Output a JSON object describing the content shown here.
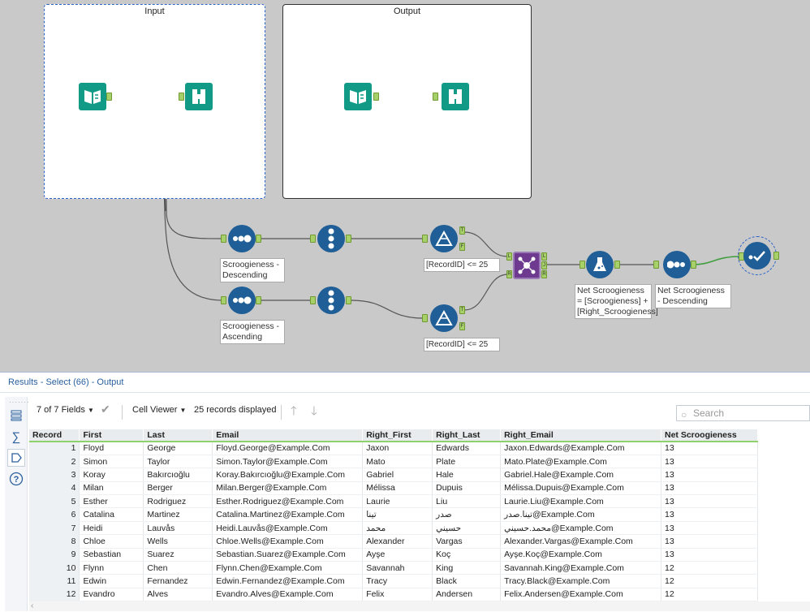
{
  "canvas": {
    "containers": [
      {
        "title": "Input"
      },
      {
        "title": "Output"
      }
    ],
    "annotations": {
      "sort_desc": "Scroogieness - Descending",
      "sort_asc": "Scroogieness - Ascending",
      "filter_top": "[RecordID] <= 25",
      "filter_bottom": "[RecordID] <= 25",
      "formula": "Net Scroogieness = [Scroogieness] + [Right_Scroogieness]",
      "sort_net": "Net Scroogieness - Descending"
    }
  },
  "results": {
    "title": "Results - Select (66) - Output",
    "toolbar": {
      "fields": "7 of 7 Fields",
      "viewer": "Cell Viewer",
      "records": "25 records displayed"
    },
    "search_placeholder": "Search",
    "columns": [
      "Record",
      "First",
      "Last",
      "Email",
      "Right_First",
      "Right_Last",
      "Right_Email",
      "Net Scroogieness"
    ],
    "rows": [
      [
        "1",
        "Floyd",
        "George",
        "Floyd.George@Example.Com",
        "Jaxon",
        "Edwards",
        "Jaxon.Edwards@Example.Com",
        "13"
      ],
      [
        "2",
        "Simon",
        "Taylor",
        "Simon.Taylor@Example.Com",
        "Mato",
        "Plate",
        "Mato.Plate@Example.Com",
        "13"
      ],
      [
        "3",
        "Koray",
        "Bakırcıoğlu",
        "Koray.Bakırcıoğlu@Example.Com",
        "Gabriel",
        "Hale",
        "Gabriel.Hale@Example.Com",
        "13"
      ],
      [
        "4",
        "Milan",
        "Berger",
        "Milan.Berger@Example.Com",
        "Mélissa",
        "Dupuis",
        "Mélissa.Dupuis@Example.Com",
        "13"
      ],
      [
        "5",
        "Esther",
        "Rodriguez",
        "Esther.Rodriguez@Example.Com",
        "Laurie",
        "Liu",
        "Laurie.Liu@Example.Com",
        "13"
      ],
      [
        "6",
        "Catalina",
        "Martinez",
        "Catalina.Martinez@Example.Com",
        "تينا",
        "صدر",
        "تينا.صدر@Example.Com",
        "13"
      ],
      [
        "7",
        "Heidi",
        "Lauvås",
        "Heidi.Lauvås@Example.Com",
        "محمد",
        "حسيني",
        "محمد.حسيني@Example.Com",
        "13"
      ],
      [
        "8",
        "Chloe",
        "Wells",
        "Chloe.Wells@Example.Com",
        "Alexander",
        "Vargas",
        "Alexander.Vargas@Example.Com",
        "13"
      ],
      [
        "9",
        "Sebastian",
        "Suarez",
        "Sebastian.Suarez@Example.Com",
        "Ayşe",
        "Koç",
        "Ayşe.Koç@Example.Com",
        "13"
      ],
      [
        "10",
        "Flynn",
        "Chen",
        "Flynn.Chen@Example.Com",
        "Savannah",
        "King",
        "Savannah.King@Example.Com",
        "12"
      ],
      [
        "11",
        "Edwin",
        "Fernandez",
        "Edwin.Fernandez@Example.Com",
        "Tracy",
        "Black",
        "Tracy.Black@Example.Com",
        "12"
      ],
      [
        "12",
        "Evandro",
        "Alves",
        "Evandro.Alves@Example.Com",
        "Felix",
        "Andersen",
        "Felix.Andersen@Example.Com",
        "12"
      ]
    ]
  }
}
